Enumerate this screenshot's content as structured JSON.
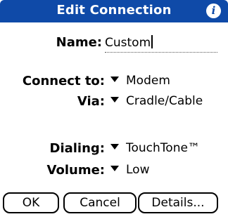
{
  "dialog": {
    "title": "Edit Connection",
    "info_icon": "i"
  },
  "fields": {
    "name_label": "Name:",
    "name_value": "Custom",
    "connect_to_label": "Connect to:",
    "connect_to_value": "Modem",
    "via_label": "Via:",
    "via_value": "Cradle/Cable",
    "dialing_label": "Dialing:",
    "dialing_value": "TouchTone™",
    "volume_label": "Volume:",
    "volume_value": "Low"
  },
  "buttons": {
    "ok": "OK",
    "cancel": "Cancel",
    "details": "Details..."
  },
  "colors": {
    "titlebar": "#0f4aa8",
    "background": "#ffffff",
    "text": "#000000"
  }
}
